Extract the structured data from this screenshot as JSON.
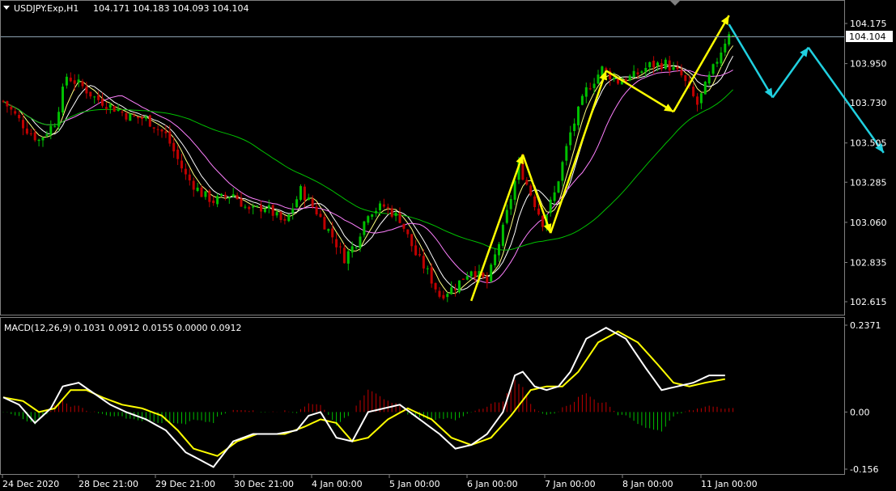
{
  "main_header": {
    "symbol": "USDJPY.Exp,H1",
    "ohlc": "104.171 104.183 104.093 104.104"
  },
  "macd_header": "MACD(12,26,9) 0.1031 0.0912 0.0155 0.0000 0.0912",
  "price_labels": [
    "104.175",
    "103.950",
    "103.730",
    "103.505",
    "103.285",
    "103.060",
    "102.835",
    "102.615"
  ],
  "current_price": "104.104",
  "macd_labels": [
    "0.2371",
    "0.00",
    "-0.156"
  ],
  "time_labels": [
    "24 Dec 2020",
    "28 Dec 21:00",
    "29 Dec 21:00",
    "30 Dec 21:00",
    "4 Jan 00:00",
    "5 Jan 00:00",
    "6 Jan 00:00",
    "7 Jan 00:00",
    "8 Jan 00:00",
    "11 Jan 00:00"
  ],
  "colors": {
    "bull": "#00c000",
    "bear": "#c00000",
    "ma_fast": "#ffff80",
    "ma_white": "#ffffff",
    "ma_pink": "#ff80ff",
    "ma_green": "#00c000",
    "macd_line": "#ffffff",
    "signal_line": "#ffff00",
    "arrow_yellow": "#ffff00",
    "arrow_cyan": "#20d0e0",
    "grid": "#808080",
    "price_line": "#8ca0b0"
  },
  "chart_data": [
    {
      "type": "candlestick",
      "title": "USDJPY.Exp,H1",
      "yticks": [
        104.175,
        103.95,
        103.73,
        103.505,
        103.285,
        103.06,
        102.835,
        102.615
      ],
      "ylim": [
        102.56,
        104.25
      ],
      "current_price": 104.104,
      "price_path": [
        [
          0,
          103.74
        ],
        [
          6,
          103.58
        ],
        [
          9,
          103.52
        ],
        [
          13,
          103.62
        ],
        [
          16,
          103.88
        ],
        [
          20,
          103.82
        ],
        [
          23,
          103.76
        ],
        [
          28,
          103.7
        ],
        [
          32,
          103.65
        ],
        [
          36,
          103.64
        ],
        [
          41,
          103.55
        ],
        [
          46,
          103.32
        ],
        [
          50,
          103.22
        ],
        [
          53,
          103.18
        ],
        [
          58,
          103.22
        ],
        [
          62,
          103.12
        ],
        [
          66,
          103.15
        ],
        [
          71,
          103.05
        ],
        [
          75,
          103.24
        ],
        [
          79,
          103.12
        ],
        [
          83,
          102.98
        ],
        [
          86,
          102.86
        ],
        [
          89,
          102.95
        ],
        [
          92,
          103.12
        ],
        [
          96,
          103.15
        ],
        [
          100,
          103.08
        ],
        [
          104,
          102.88
        ],
        [
          107,
          102.78
        ],
        [
          110,
          102.65
        ],
        [
          114,
          102.7
        ],
        [
          118,
          102.8
        ],
        [
          122,
          102.72
        ],
        [
          126,
          103.02
        ],
        [
          130,
          103.38
        ],
        [
          133,
          103.22
        ],
        [
          136,
          103.06
        ],
        [
          139,
          103.22
        ],
        [
          143,
          103.56
        ],
        [
          147,
          103.8
        ],
        [
          151,
          103.92
        ],
        [
          155,
          103.85
        ],
        [
          159,
          103.88
        ],
        [
          163,
          103.94
        ],
        [
          167,
          103.95
        ],
        [
          171,
          103.88
        ],
        [
          175,
          103.72
        ],
        [
          179,
          103.92
        ],
        [
          183,
          104.13
        ],
        [
          184,
          104.1
        ]
      ],
      "overlay_arrows": [
        {
          "color": "yellow",
          "from": [
            118,
            102.62
          ],
          "to": [
            131,
            103.44
          ]
        },
        {
          "color": "yellow",
          "from": [
            131,
            103.44
          ],
          "to": [
            138,
            103.0
          ]
        },
        {
          "color": "yellow",
          "from": [
            138,
            103.0
          ],
          "to": [
            152,
            103.91
          ]
        },
        {
          "color": "yellow",
          "from": [
            152,
            103.91
          ],
          "to": [
            169,
            103.68
          ]
        },
        {
          "color": "yellow",
          "from": [
            169,
            103.68
          ],
          "to": [
            183,
            104.22
          ]
        },
        {
          "color": "cyan",
          "from": [
            183,
            104.17
          ],
          "to": [
            194,
            103.76
          ]
        },
        {
          "color": "cyan",
          "from": [
            194,
            103.76
          ],
          "to": [
            203,
            104.04
          ]
        },
        {
          "color": "cyan",
          "from": [
            203,
            104.04
          ],
          "to": [
            222,
            103.45
          ]
        }
      ]
    },
    {
      "type": "macd",
      "title": "MACD(12,26,9)",
      "values": {
        "macd": 0.1031,
        "signal": 0.0912,
        "histogram": 0.0155
      },
      "yticks": [
        0.2371,
        0.0,
        -0.156
      ],
      "ylim": [
        -0.156,
        0.2371
      ],
      "macd_path": [
        [
          0,
          0.04
        ],
        [
          4,
          0.02
        ],
        [
          8,
          -0.03
        ],
        [
          12,
          0.01
        ],
        [
          15,
          0.07
        ],
        [
          19,
          0.08
        ],
        [
          23,
          0.05
        ],
        [
          27,
          0.02
        ],
        [
          31,
          0.0
        ],
        [
          36,
          -0.02
        ],
        [
          41,
          -0.05
        ],
        [
          46,
          -0.11
        ],
        [
          53,
          -0.15
        ],
        [
          58,
          -0.08
        ],
        [
          63,
          -0.06
        ],
        [
          69,
          -0.06
        ],
        [
          74,
          -0.05
        ],
        [
          77,
          -0.01
        ],
        [
          80,
          -0.0
        ],
        [
          84,
          -0.07
        ],
        [
          88,
          -0.08
        ],
        [
          92,
          0.0
        ],
        [
          96,
          0.01
        ],
        [
          100,
          0.02
        ],
        [
          105,
          -0.02
        ],
        [
          110,
          -0.06
        ],
        [
          114,
          -0.1
        ],
        [
          118,
          -0.09
        ],
        [
          122,
          -0.06
        ],
        [
          126,
          0.0
        ],
        [
          129,
          0.1
        ],
        [
          131,
          0.11
        ],
        [
          134,
          0.07
        ],
        [
          137,
          0.06
        ],
        [
          140,
          0.07
        ],
        [
          143,
          0.11
        ],
        [
          147,
          0.2
        ],
        [
          152,
          0.23
        ],
        [
          157,
          0.2
        ],
        [
          162,
          0.12
        ],
        [
          166,
          0.06
        ],
        [
          170,
          0.07
        ],
        [
          174,
          0.08
        ],
        [
          178,
          0.1
        ],
        [
          182,
          0.1
        ]
      ],
      "signal_path": [
        [
          0,
          0.04
        ],
        [
          5,
          0.03
        ],
        [
          9,
          0.0
        ],
        [
          13,
          0.01
        ],
        [
          17,
          0.06
        ],
        [
          21,
          0.06
        ],
        [
          25,
          0.04
        ],
        [
          30,
          0.02
        ],
        [
          35,
          0.01
        ],
        [
          40,
          -0.01
        ],
        [
          44,
          -0.05
        ],
        [
          48,
          -0.1
        ],
        [
          54,
          -0.12
        ],
        [
          59,
          -0.08
        ],
        [
          64,
          -0.06
        ],
        [
          71,
          -0.06
        ],
        [
          76,
          -0.04
        ],
        [
          80,
          -0.02
        ],
        [
          84,
          -0.03
        ],
        [
          88,
          -0.08
        ],
        [
          92,
          -0.07
        ],
        [
          97,
          -0.02
        ],
        [
          102,
          0.01
        ],
        [
          108,
          -0.02
        ],
        [
          113,
          -0.07
        ],
        [
          118,
          -0.09
        ],
        [
          123,
          -0.07
        ],
        [
          128,
          -0.01
        ],
        [
          133,
          0.06
        ],
        [
          137,
          0.07
        ],
        [
          141,
          0.07
        ],
        [
          145,
          0.11
        ],
        [
          150,
          0.19
        ],
        [
          155,
          0.22
        ],
        [
          160,
          0.19
        ],
        [
          165,
          0.13
        ],
        [
          169,
          0.08
        ],
        [
          173,
          0.07
        ],
        [
          177,
          0.08
        ],
        [
          182,
          0.09
        ]
      ]
    }
  ]
}
